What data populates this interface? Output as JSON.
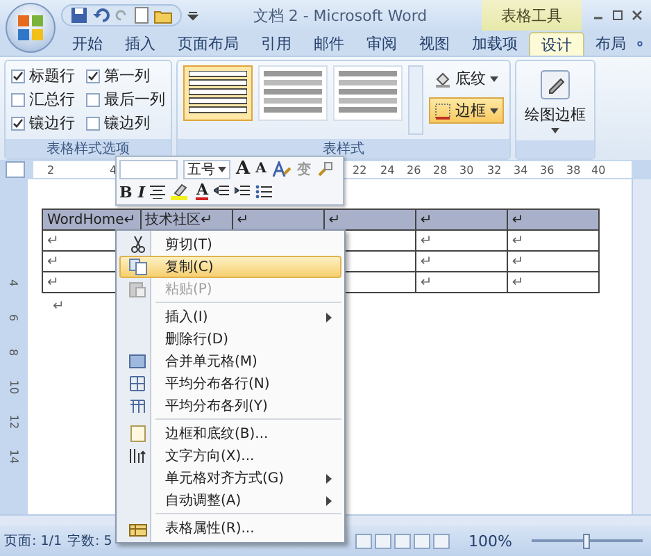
{
  "title_bar": {
    "title": "文档 2 - Microsoft Word",
    "context_label": "表格工具"
  },
  "tabs": [
    {
      "label": "开始",
      "selected": false
    },
    {
      "label": "插入",
      "selected": false
    },
    {
      "label": "页面布局",
      "selected": false
    },
    {
      "label": "引用",
      "selected": false
    },
    {
      "label": "邮件",
      "selected": false
    },
    {
      "label": "审阅",
      "selected": false
    },
    {
      "label": "视图",
      "selected": false
    },
    {
      "label": "加载项",
      "selected": false
    },
    {
      "label": "设计",
      "selected": true
    },
    {
      "label": "布局",
      "selected": false
    }
  ],
  "ribbon": {
    "groups": [
      {
        "kind": "options",
        "label": "表格样式选项",
        "options": [
          {
            "label": "标题行",
            "checked": true
          },
          {
            "label": "第一列",
            "checked": true
          },
          {
            "label": "汇总行",
            "checked": false
          },
          {
            "label": "最后一列",
            "checked": false
          },
          {
            "label": "镶边行",
            "checked": true
          },
          {
            "label": "镶边列",
            "checked": false
          }
        ]
      },
      {
        "kind": "gallery",
        "label": "表样式",
        "styles": [
          {
            "selected": true
          },
          {
            "selected": false
          },
          {
            "selected": false
          }
        ],
        "buttons": [
          {
            "label": "底纹",
            "selected": false
          },
          {
            "label": "边框",
            "selected": true
          }
        ]
      },
      {
        "kind": "draw",
        "label": "绘图边框"
      }
    ]
  },
  "mini_toolbar": {
    "font_size": "五号",
    "grow_glyph": "A",
    "shrink_glyph": "A",
    "phonetic_glyph": "变",
    "bold_glyph": "B",
    "italic_glyph": "I",
    "font_color_glyph": "A"
  },
  "ruler": {
    "labels": [
      "2",
      "4",
      "22",
      "24",
      "26",
      "28",
      "30",
      "32",
      "34",
      "36",
      "38",
      "40"
    ]
  },
  "vertical_ruler": {
    "labels": [
      "4",
      "6",
      "8",
      "10",
      "12",
      "14"
    ]
  },
  "table": {
    "rows": [
      {
        "shaded": true,
        "cells": [
          "WordHome↵",
          "技术社区↵",
          "↵",
          "↵",
          "↵",
          "↵"
        ]
      },
      {
        "shaded": false,
        "cells": [
          "↵",
          null,
          null,
          null,
          "↵",
          "↵"
        ]
      },
      {
        "shaded": false,
        "cells": [
          "↵",
          null,
          null,
          null,
          "↵",
          "↵"
        ]
      },
      {
        "shaded": false,
        "cells": [
          "↵",
          null,
          null,
          null,
          "↵",
          "↵"
        ]
      }
    ]
  },
  "paragraph_mark": "↵",
  "context_menu": {
    "items": [
      {
        "kind": "item",
        "label": "剪切(T)",
        "selected": false,
        "disabled": false,
        "submenu": false
      },
      {
        "kind": "item",
        "label": "复制(C)",
        "selected": true,
        "disabled": false,
        "submenu": false
      },
      {
        "kind": "item",
        "label": "粘贴(P)",
        "selected": false,
        "disabled": true,
        "submenu": false
      },
      {
        "kind": "separator"
      },
      {
        "kind": "item",
        "label": "插入(I)",
        "selected": false,
        "disabled": false,
        "submenu": true
      },
      {
        "kind": "item",
        "label": "删除行(D)",
        "selected": false,
        "disabled": false,
        "submenu": false
      },
      {
        "kind": "item",
        "label": "合并单元格(M)",
        "selected": false,
        "disabled": false,
        "submenu": false
      },
      {
        "kind": "item",
        "label": "平均分布各行(N)",
        "selected": false,
        "disabled": false,
        "submenu": false
      },
      {
        "kind": "item",
        "label": "平均分布各列(Y)",
        "selected": false,
        "disabled": false,
        "submenu": false
      },
      {
        "kind": "separator"
      },
      {
        "kind": "item",
        "label": "边框和底纹(B)...",
        "selected": false,
        "disabled": false,
        "submenu": false
      },
      {
        "kind": "item",
        "label": "文字方向(X)...",
        "selected": false,
        "disabled": false,
        "submenu": false
      },
      {
        "kind": "item",
        "label": "单元格对齐方式(G)",
        "selected": false,
        "disabled": false,
        "submenu": true
      },
      {
        "kind": "item",
        "label": "自动调整(A)",
        "selected": false,
        "disabled": false,
        "submenu": true
      },
      {
        "kind": "separator"
      },
      {
        "kind": "item",
        "label": "表格属性(R)...",
        "selected": false,
        "disabled": false,
        "submenu": false
      }
    ]
  },
  "status_bar": {
    "page": "页面: 1/1",
    "words": "字数: 5",
    "zoom": "100%",
    "zoom_slider": {
      "level": 0.5
    }
  }
}
